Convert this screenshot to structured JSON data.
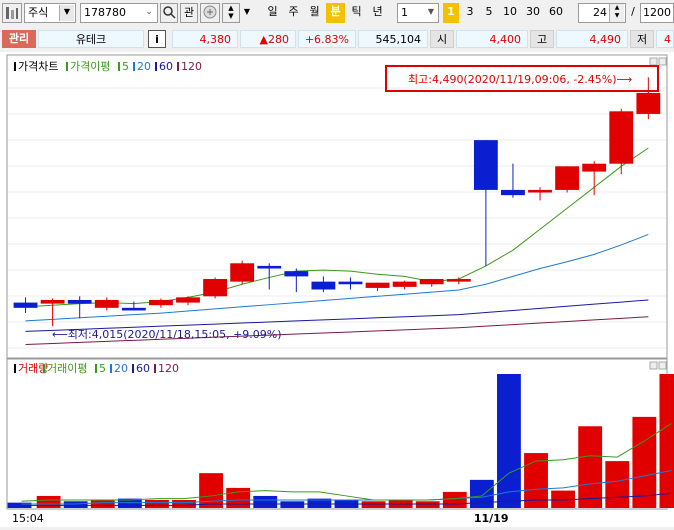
{
  "toolbar": {
    "market_select": "주식",
    "code_input": "178780",
    "search_label": "관",
    "period_buttons": [
      "일",
      "주",
      "월",
      "분",
      "틱",
      "년"
    ],
    "active_period": "분",
    "interval_select": "1",
    "interval_buttons": [
      "1",
      "3",
      "5",
      "10",
      "30",
      "60"
    ],
    "active_interval": "1",
    "count_input": "24",
    "slash": "/",
    "total_input": "1200"
  },
  "info": {
    "badge": "관리",
    "name": "유테크",
    "info_button": "i",
    "price": "4,380",
    "change": "▲280",
    "rate": "+6.83%",
    "volume": "545,104",
    "open_label": "시",
    "open_value": "4,400",
    "high_label": "고",
    "high_value": "4,490",
    "low_label": "저",
    "low_value": "4"
  },
  "colors": {
    "up": "#e00000",
    "down": "#0a1fd0",
    "ma5": "#3a9a1a",
    "ma20": "#1a7ad8",
    "ma60": "#1a1a9a",
    "ma120": "#7a1a4a",
    "highlight": "#e00000"
  },
  "price_panel": {
    "legend": [
      {
        "text": "가격차트",
        "color": "#000000"
      },
      {
        "text": "가격이평",
        "color": "#3a9a1a"
      },
      {
        "text": "5",
        "color": "#3a9a1a"
      },
      {
        "text": "20",
        "color": "#1a7ad8"
      },
      {
        "text": "60",
        "color": "#1a1a9a"
      },
      {
        "text": "120",
        "color": "#7a1a4a"
      }
    ],
    "high_annotation": "최고:4,490(2020/11/19,09:06, -2.45%)⟶",
    "low_annotation": "⟵최저:4,015(2020/11/18,15:05, +9.09%)"
  },
  "volume_panel": {
    "legend": [
      {
        "text": "거래량",
        "color": "#e00000"
      },
      {
        "text": "거래이평",
        "color": "#3a9a1a"
      },
      {
        "text": "5",
        "color": "#3a9a1a"
      },
      {
        "text": "20",
        "color": "#1a7ad8"
      },
      {
        "text": "60",
        "color": "#1a1a9a"
      },
      {
        "text": "120",
        "color": "#7a1a4a"
      }
    ]
  },
  "x_labels": [
    {
      "text": "15:04",
      "index": 0
    },
    {
      "text": "11/19",
      "index": 17
    }
  ],
  "chart_data": {
    "type": "candlestick",
    "series": [
      {
        "o": 4060,
        "h": 4070,
        "l": 4040,
        "c": 4050
      },
      {
        "o": 4058,
        "h": 4068,
        "l": 4015,
        "c": 4065
      },
      {
        "o": 4065,
        "h": 4072,
        "l": 4030,
        "c": 4058
      },
      {
        "o": 4050,
        "h": 4070,
        "l": 4045,
        "c": 4065
      },
      {
        "o": 4050,
        "h": 4062,
        "l": 4045,
        "c": 4045
      },
      {
        "o": 4055,
        "h": 4068,
        "l": 4050,
        "c": 4065
      },
      {
        "o": 4060,
        "h": 4072,
        "l": 4055,
        "c": 4070
      },
      {
        "o": 4072,
        "h": 4108,
        "l": 4068,
        "c": 4105
      },
      {
        "o": 4100,
        "h": 4140,
        "l": 4095,
        "c": 4135
      },
      {
        "o": 4130,
        "h": 4135,
        "l": 4085,
        "c": 4125
      },
      {
        "o": 4120,
        "h": 4125,
        "l": 4080,
        "c": 4110
      },
      {
        "o": 4100,
        "h": 4110,
        "l": 4080,
        "c": 4085
      },
      {
        "o": 4100,
        "h": 4108,
        "l": 4085,
        "c": 4095
      },
      {
        "o": 4088,
        "h": 4098,
        "l": 4082,
        "c": 4098
      },
      {
        "o": 4090,
        "h": 4102,
        "l": 4085,
        "c": 4100
      },
      {
        "o": 4095,
        "h": 4105,
        "l": 4090,
        "c": 4105
      },
      {
        "o": 4100,
        "h": 4108,
        "l": 4095,
        "c": 4105
      },
      {
        "o": 4370,
        "h": 4370,
        "l": 4130,
        "c": 4275
      },
      {
        "o": 4275,
        "h": 4325,
        "l": 4260,
        "c": 4265
      },
      {
        "o": 4270,
        "h": 4280,
        "l": 4255,
        "c": 4275
      },
      {
        "o": 4275,
        "h": 4320,
        "l": 4270,
        "c": 4320
      },
      {
        "o": 4310,
        "h": 4330,
        "l": 4265,
        "c": 4325
      },
      {
        "o": 4325,
        "h": 4430,
        "l": 4305,
        "c": 4425
      },
      {
        "o": 4420,
        "h": 4490,
        "l": 4410,
        "c": 4460
      }
    ],
    "ma5": [
      4052,
      4055,
      4058,
      4060,
      4058,
      4062,
      4070,
      4080,
      4095,
      4108,
      4120,
      4122,
      4120,
      4114,
      4110,
      4100,
      4105,
      4130,
      4160,
      4200,
      4240,
      4280,
      4320,
      4355
    ],
    "ma20": [
      4025,
      4028,
      4031,
      4034,
      4037,
      4040,
      4044,
      4048,
      4052,
      4056,
      4060,
      4064,
      4068,
      4072,
      4076,
      4080,
      4084,
      4095,
      4110,
      4125,
      4138,
      4152,
      4170,
      4190
    ],
    "ma60": [
      4005,
      4007,
      4009,
      4011,
      4013,
      4015,
      4017,
      4019,
      4021,
      4023,
      4025,
      4027,
      4029,
      4031,
      4033,
      4035,
      4037,
      4041,
      4045,
      4049,
      4053,
      4057,
      4061,
      4065
    ],
    "ma120": [
      3980,
      3982,
      3984,
      3986,
      3988,
      3990,
      3992,
      3994,
      3996,
      3998,
      4000,
      4002,
      4004,
      4006,
      4008,
      4010,
      4012,
      4015,
      4018,
      4021,
      4024,
      4027,
      4030,
      4033
    ],
    "price_range": [
      3960,
      4500
    ],
    "volume": [
      4,
      9,
      5,
      6,
      7,
      6,
      6,
      26,
      15,
      9,
      5,
      7,
      6,
      5,
      6,
      5,
      12,
      21,
      100,
      41,
      13,
      61,
      35,
      68,
      100
    ],
    "vol_ma5": [
      5,
      6,
      6,
      6,
      6,
      7,
      7,
      9,
      12,
      13,
      12,
      12,
      9,
      6,
      6,
      6,
      7,
      9,
      26,
      35,
      36,
      39,
      38,
      50,
      63
    ],
    "vol_ma20": [
      3,
      3,
      3,
      4,
      4,
      4,
      4,
      5,
      6,
      6,
      6,
      6,
      6,
      6,
      6,
      6,
      7,
      8,
      12,
      14,
      15,
      18,
      20,
      24,
      28
    ],
    "vol_ma60": [
      2,
      2,
      2,
      2,
      2,
      2,
      2,
      3,
      3,
      3,
      3,
      3,
      3,
      3,
      3,
      3,
      3,
      4,
      5,
      6,
      6,
      7,
      8,
      9,
      11
    ]
  }
}
